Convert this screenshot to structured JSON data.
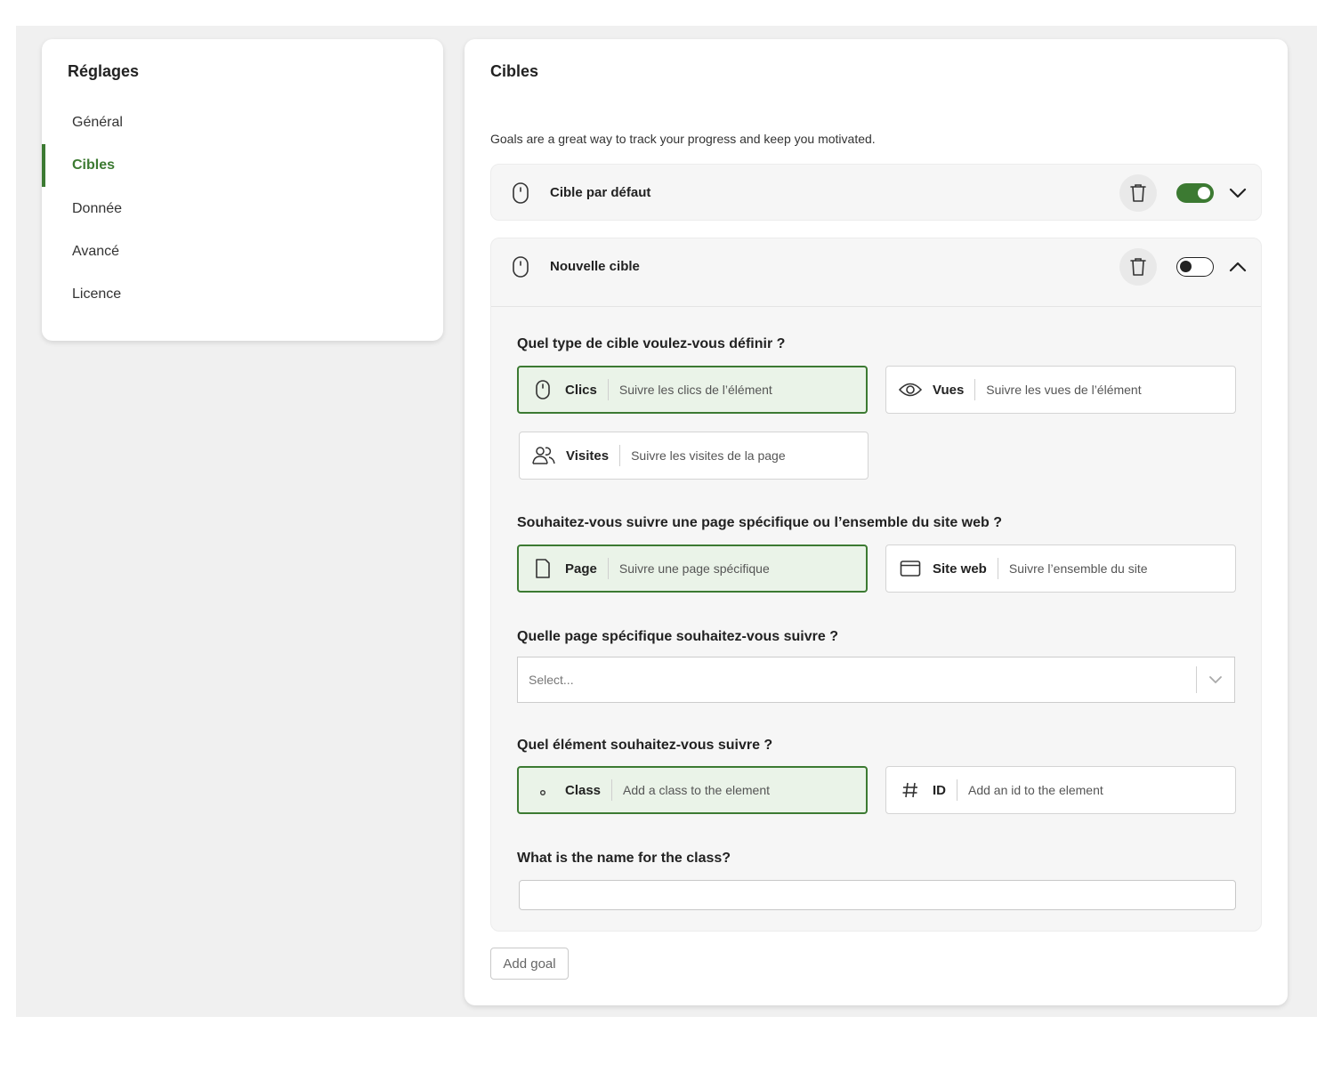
{
  "sidebar": {
    "title": "Réglages",
    "items": [
      {
        "label": "Général",
        "active": false
      },
      {
        "label": "Cibles",
        "active": true
      },
      {
        "label": "Donnée",
        "active": false
      },
      {
        "label": "Avancé",
        "active": false
      },
      {
        "label": "Licence",
        "active": false
      }
    ]
  },
  "main": {
    "title": "Cibles",
    "description": "Goals are a great way to track your progress and keep you motivated.",
    "goals": [
      {
        "name": "Cible par défaut",
        "enabled": true,
        "expanded": false
      },
      {
        "name": "Nouvelle cible",
        "enabled": false,
        "expanded": true
      }
    ],
    "q1": {
      "question": "Quel type de cible voulez-vous définir ?",
      "options": [
        {
          "label": "Clics",
          "desc": "Suivre les clics de l’élément",
          "icon": "mouse-icon",
          "selected": true
        },
        {
          "label": "Vues",
          "desc": "Suivre les vues de l’élément",
          "icon": "eye-icon",
          "selected": false
        },
        {
          "label": "Visites",
          "desc": "Suivre les visites de la page",
          "icon": "users-icon",
          "selected": false
        }
      ]
    },
    "q2": {
      "question": "Souhaitez-vous suivre une page spécifique ou l’ensemble du site web ?",
      "options": [
        {
          "label": "Page",
          "desc": "Suivre une page spécifique",
          "icon": "file-icon",
          "selected": true
        },
        {
          "label": "Site web",
          "desc": "Suivre l’ensemble du site",
          "icon": "browser-icon",
          "selected": false
        }
      ]
    },
    "q3": {
      "question": "Quelle page spécifique souhaitez-vous suivre ?",
      "placeholder": "Select..."
    },
    "q4": {
      "question": "Quel élément souhaitez-vous suivre ?",
      "options": [
        {
          "label": "Class",
          "desc": "Add a class to the element",
          "icon": "dot-icon",
          "selected": true
        },
        {
          "label": "ID",
          "desc": "Add an id to the element",
          "icon": "hash-icon",
          "selected": false
        }
      ]
    },
    "q5": {
      "question": "What is the name for the class?",
      "value": ""
    },
    "add_goal_label": "Add goal"
  },
  "colors": {
    "accent": "#3c7a32",
    "selected_bg": "#eaf3e8",
    "page_bg": "#f0f0f0"
  }
}
